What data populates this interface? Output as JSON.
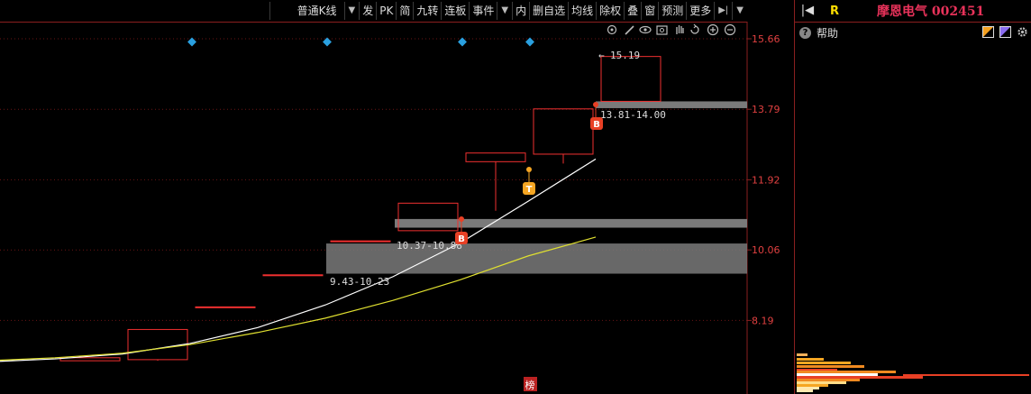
{
  "toolbar": {
    "chart_type": "普通K线",
    "items": [
      "发",
      "PK",
      "简",
      "九转",
      "连板",
      "事件"
    ],
    "items2": [
      "内",
      "删自选",
      "均线",
      "除权",
      "叠",
      "窗",
      "预测",
      "更多"
    ]
  },
  "price_axis": {
    "ticks": [
      "15.66",
      "13.79",
      "11.92",
      "10.06",
      "8.19"
    ],
    "values": [
      15.66,
      13.79,
      11.92,
      10.06,
      8.19
    ],
    "range": [
      7.0,
      16.5
    ],
    "color": "#e04040"
  },
  "annotations": {
    "high_label": "15.19",
    "zone1_label": "13.81-14.00",
    "zone2_label": "10.37-10.88",
    "zone3_label": "9.43-10.23",
    "marker_b": "B",
    "marker_t": "T",
    "bottom_tag": "榜"
  },
  "chart_data": {
    "type": "candlestick",
    "candles": [
      {
        "open": 7.2,
        "close": 7.12,
        "high": 7.2,
        "low": 7.12
      },
      {
        "open": 7.95,
        "close": 7.15,
        "high": 7.95,
        "low": 7.12
      },
      {
        "open": 8.55,
        "close": 8.55,
        "high": 8.55,
        "low": 8.55
      },
      {
        "open": 9.4,
        "close": 9.4,
        "high": 9.4,
        "low": 9.4
      },
      {
        "open": 10.3,
        "close": 10.3,
        "high": 10.3,
        "low": 10.3
      },
      {
        "open": 10.57,
        "close": 11.3,
        "high": 11.3,
        "low": 10.57
      },
      {
        "open": 12.4,
        "close": 12.63,
        "high": 12.63,
        "low": 11.1
      },
      {
        "open": 12.6,
        "close": 13.8,
        "high": 13.8,
        "low": 12.35
      },
      {
        "open": 14.0,
        "close": 15.19,
        "high": 15.19,
        "low": 14.0
      }
    ],
    "ma_short": [
      7.09,
      7.17,
      7.3,
      7.58,
      8.0,
      8.6,
      9.35,
      10.25,
      11.35,
      12.47
    ],
    "ma_long": [
      7.09,
      7.12,
      7.2,
      7.32,
      7.55,
      7.87,
      8.25,
      8.72,
      9.27,
      9.9,
      10.4
    ],
    "colors": {
      "up": "#f03030",
      "ma_short": "#ffffff",
      "ma_long": "#e0e030",
      "zone": "#7a7a7a",
      "diamond": "#2aa0e0",
      "marker": "#e84025",
      "marker_t": "#f5a623"
    }
  },
  "right_panel": {
    "badge": "R",
    "title": "摩恩电气 002451",
    "help": "帮助"
  }
}
